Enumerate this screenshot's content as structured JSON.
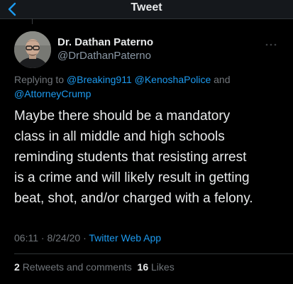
{
  "header": {
    "title": "Tweet",
    "back_icon": "chevron-left-icon"
  },
  "tweet": {
    "author": {
      "display_name": "Dr. Dathan Paterno",
      "handle": "@DrDathanPaterno",
      "avatar_icon": "avatar-photo"
    },
    "more_icon": "more-horizontal-icon",
    "reply_context": {
      "prefix": "Replying to",
      "mentions": [
        "@Breaking911",
        "@KenoshaPolice",
        "@AttorneyCrump"
      ],
      "conjunction": "and"
    },
    "text_lines": [
      "Maybe there should be a mandatory",
      "class in all middle and high schools",
      "reminding students that resisting arrest",
      "is a crime and will likely result in getting",
      "beat, shot, and/or charged with a felony."
    ],
    "time": "06:11",
    "date": "8/24/20",
    "separator": "·",
    "source": "Twitter Web App",
    "retweets_count": "2",
    "retweets_label": "Retweets and comments",
    "likes_count": "16",
    "likes_label": "Likes"
  },
  "colors": {
    "background": "#000000",
    "accent": "#1d9bf0",
    "secondary_text": "#71767b",
    "primary_text": "#e7e9ea"
  }
}
